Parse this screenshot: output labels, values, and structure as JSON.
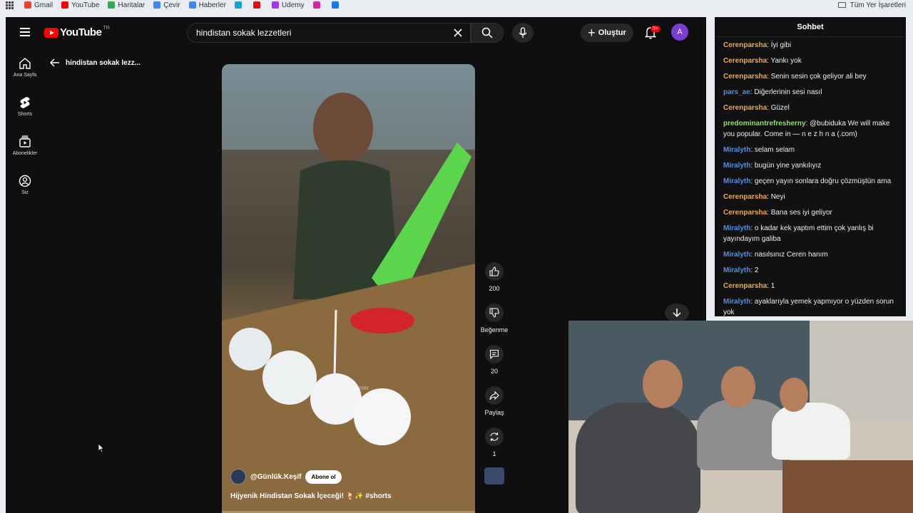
{
  "bookmarks": {
    "items": [
      {
        "label": "Gmail",
        "color": "#ea4335"
      },
      {
        "label": "YouTube",
        "color": "#ff0000"
      },
      {
        "label": "Haritalar",
        "color": "#34a853"
      },
      {
        "label": "Çevir",
        "color": "#4285f4"
      },
      {
        "label": "Haberler",
        "color": "#4285f4"
      },
      {
        "label": "",
        "color": "#1aa3c8"
      },
      {
        "label": "",
        "color": "#e50914"
      },
      {
        "label": "Udemy",
        "color": "#a435f0"
      },
      {
        "label": "",
        "color": "#d6249f"
      },
      {
        "label": "",
        "color": "#1877f2"
      }
    ],
    "all_bookmarks": "Tüm Yer İşaretleri"
  },
  "youtube": {
    "logo_text": "YouTube",
    "logo_region": "TR",
    "search_value": "hindistan sokak lezzetleri",
    "create_label": "Oluştur",
    "notification_badge": "9+",
    "avatar_letter": "A",
    "sidebar": [
      {
        "label": "Ana Sayfa",
        "icon": "home-icon"
      },
      {
        "label": "Shorts",
        "icon": "shorts-icon"
      },
      {
        "label": "Abonelikler",
        "icon": "subscriptions-icon"
      },
      {
        "label": "Siz",
        "icon": "you-icon"
      }
    ],
    "back_title": "hindistan sokak lezz...",
    "video": {
      "watermark": "Street Food Hunter",
      "channel": "@Günlük.Keşif",
      "subscribe": "Abone ol",
      "caption": "Hijyenik Hindistan Sokak İçeceği! 🍹✨ #shorts"
    },
    "actions": {
      "likes": "200",
      "dislike_label": "Beğenme",
      "comments": "20",
      "share_label": "Paylaş",
      "remix": "1"
    }
  },
  "chat": {
    "title": "Sohbet",
    "messages": [
      {
        "user": "Cerenparsha",
        "text": "İyi gibi",
        "color": "#f0a94a"
      },
      {
        "user": "Cerenparsha",
        "text": "Yankı yok",
        "color": "#f0a94a"
      },
      {
        "user": "Cerenparsha",
        "text": "Senin sesin çok geliyor ali bey",
        "color": "#f0a94a"
      },
      {
        "user": "pars_ae",
        "text": "Diğerlerinin sesi nasıl",
        "color": "#4d8fe8"
      },
      {
        "user": "Cerenparsha",
        "text": "Güzel",
        "color": "#f0a94a"
      },
      {
        "user": "predominantrefresherny",
        "text": "@bubiduka We will make you popular. Come in — n e z h n a (.com)",
        "color": "#8be25c"
      },
      {
        "user": "Miralyth",
        "text": "selam selam",
        "color": "#4d8fe8"
      },
      {
        "user": "Miralyth",
        "text": "bugün yine yankılıyız",
        "color": "#4d8fe8"
      },
      {
        "user": "Miralyth",
        "text": "geçen yayın sonlara doğru çözmüştün ama",
        "color": "#4d8fe8"
      },
      {
        "user": "Cerenparsha",
        "text": "Neyi",
        "color": "#f0a94a"
      },
      {
        "user": "Cerenparsha",
        "text": "Bana ses iyi geliyor",
        "color": "#f0a94a"
      },
      {
        "user": "Miralyth",
        "text": "o kadar kek yaptım ettim çok yanlış bi yayındayım galiba",
        "color": "#4d8fe8"
      },
      {
        "user": "Miralyth",
        "text": "nasılsınız Ceren hanım",
        "color": "#4d8fe8"
      },
      {
        "user": "Miralyth",
        "text": "2",
        "color": "#4d8fe8"
      },
      {
        "user": "Cerenparsha",
        "text": "1",
        "color": "#f0a94a"
      },
      {
        "user": "Miralyth",
        "text": "ayaklarıyla yemek yapmıyor o yüzden sorun yok",
        "color": "#4d8fe8"
      }
    ]
  }
}
